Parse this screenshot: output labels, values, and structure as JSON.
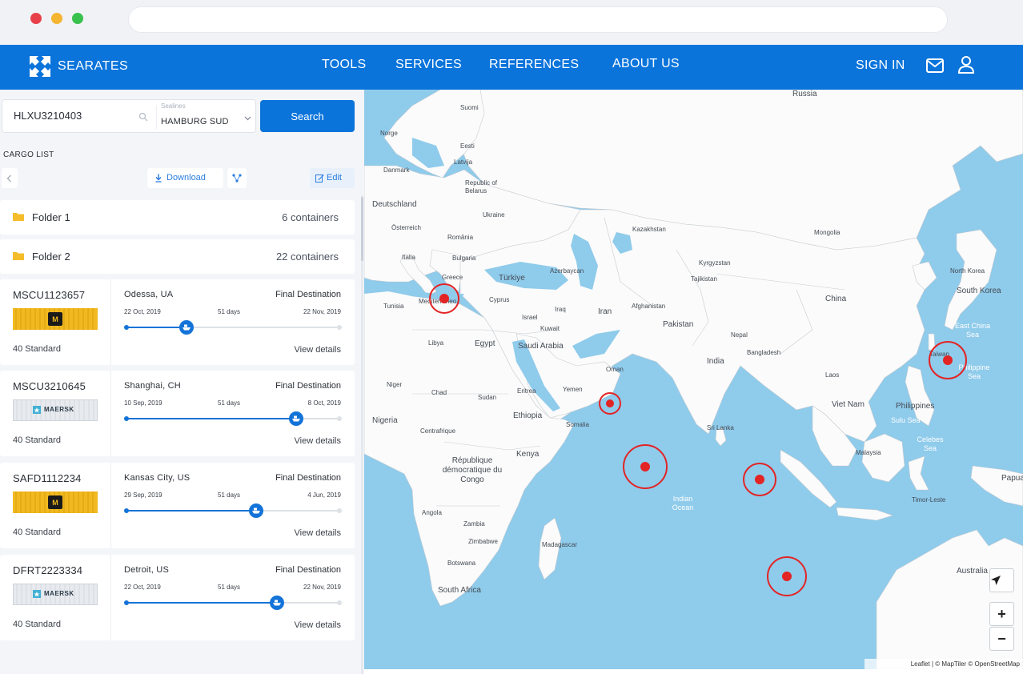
{
  "navbar": {
    "brand": "SEARATES",
    "links": [
      "TOOLS",
      "SERVICES",
      "REFERENCES",
      "ABOUT US"
    ],
    "signin": "SIGN IN"
  },
  "search": {
    "container_number": "HLXU3210403",
    "sealine_label": "Sealines",
    "sealine_value": "HAMBURG SUD",
    "button": "Search"
  },
  "cargo": {
    "title": "CARGO LIST",
    "download": "Download",
    "edit": "Edit",
    "folders": [
      {
        "name": "Folder 1",
        "count": "6 containers"
      },
      {
        "name": "Folder 2",
        "count": "22 containers"
      }
    ],
    "cards": [
      {
        "id": "MSCU1123657",
        "carrier": "msc",
        "type": "40 Standard",
        "origin": "Odessa, UA",
        "dest_label": "Final Destination",
        "dep": "22 Oct, 2019",
        "duration": "51 days",
        "arr": "22 Nov, 2019",
        "progress": 0.28,
        "view": "View details"
      },
      {
        "id": "MSCU3210645",
        "carrier": "maersk",
        "carrier_text": "MAERSK",
        "type": "40 Standard",
        "origin": "Shanghai, CH",
        "dest_label": "Final Destination",
        "dep": "10 Sep, 2019",
        "duration": "51 days",
        "arr": "8 Oct, 2019",
        "progress": 0.8,
        "view": "View details"
      },
      {
        "id": "SAFD1112234",
        "carrier": "msc",
        "type": "40 Standard",
        "origin": "Kansas City, US",
        "dest_label": "Final Destination",
        "dep": "29 Sep, 2019",
        "duration": "51 days",
        "arr": "4 Jun, 2019",
        "progress": 0.61,
        "view": "View details"
      },
      {
        "id": "DFRT2223334",
        "carrier": "maersk",
        "carrier_text": "MAERSK",
        "type": "40 Standard",
        "origin": "Detroit, US",
        "dest_label": "Final Destination",
        "dep": "22 Oct, 2019",
        "duration": "51 days",
        "arr": "22 Nov, 2019",
        "progress": 0.71,
        "view": "View details"
      }
    ]
  },
  "map": {
    "labels": [
      "Russia",
      "Suomi",
      "Norge",
      "Eesti",
      "Latvija",
      "Danmark",
      "Republic of Belarus",
      "Deutschland",
      "Ukraine",
      "Kazakhstan",
      "Mongolia",
      "Österreich",
      "România",
      "Italia",
      "Bulgaria",
      "Kyrgyzstan",
      "Tajikistan",
      "Azerbaycan",
      "Türkiye",
      "Greece",
      "North Korea",
      "South Korea",
      "China",
      "Tunisia",
      "Mediterraneo",
      "Cyprus",
      "Iraq",
      "Iran",
      "Afghanistan",
      "Israel",
      "Kuwait",
      "Pakistan",
      "Nepal",
      "Libya",
      "Egypt",
      "Saudi Arabia",
      "Bangladesh",
      "India",
      "East China Sea",
      "Taiwan",
      "Philippine Sea",
      "Niger",
      "Chad",
      "Sudan",
      "Eritrea",
      "Yemen",
      "Oman",
      "Laos",
      "Viet Nam",
      "Philippines",
      "Nigeria",
      "Centrafrique",
      "Ethiopia",
      "Somalia",
      "Sri Lanka",
      "Sulu Sea",
      "Celebes Sea",
      "Malaysia",
      "Kenya",
      "République démocratique du Congo",
      "Indian Ocean",
      "Papua",
      "Timor-Leste",
      "Angola",
      "Zambia",
      "Zimbabwe",
      "Madagascar",
      "Botswana",
      "South Africa",
      "Australia"
    ],
    "attribution": "Leaflet | © MapTiler © OpenStreetMap",
    "zoom_in": "+",
    "zoom_out": "−"
  }
}
